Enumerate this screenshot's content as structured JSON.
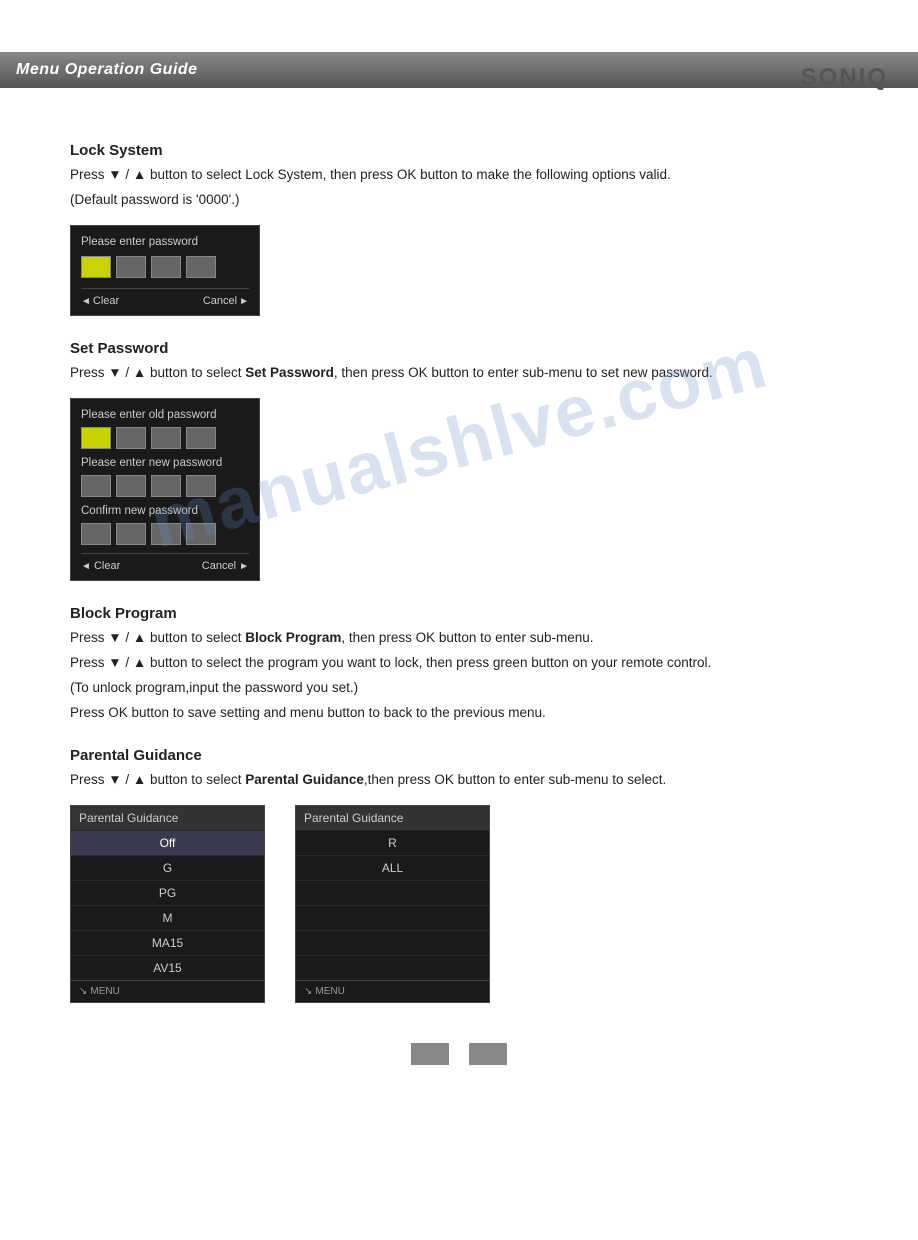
{
  "logo": {
    "text": "SONIQ"
  },
  "header": {
    "title": "Menu Operation Guide"
  },
  "sections": {
    "lock_system": {
      "title": "Lock System",
      "desc1": "Press ▼ / ▲ button to select Lock System, then press OK button to make the following options valid.",
      "desc2": "(Default password is '0000'.)",
      "dialog": {
        "label": "Please enter password",
        "boxes": [
          "active",
          "inactive",
          "inactive",
          "inactive"
        ],
        "footer_left": "◄Clear",
        "footer_right": "Cancel►"
      }
    },
    "set_password": {
      "title": "Set Password",
      "desc": "Press ▼ / ▲ button to select Set Password, then press OK button to enter sub-menu to set new password.",
      "dialog": {
        "label1": "Please enter old password",
        "boxes1": [
          "active",
          "inactive",
          "inactive",
          "inactive"
        ],
        "label2": "Please enter new password",
        "boxes2": [
          "inactive",
          "inactive",
          "inactive",
          "inactive"
        ],
        "label3": "Confirm new password",
        "boxes3": [
          "inactive",
          "inactive",
          "inactive",
          "inactive"
        ],
        "footer_left": "◄Clear",
        "footer_right": "Cancel►"
      }
    },
    "block_program": {
      "title": "Block Program",
      "desc1": "Press ▼ / ▲ button to select Block Program, then press OK button to enter sub-menu.",
      "desc2": "Press ▼ / ▲ button to select the program you want to lock, then press green button on your remote control.",
      "desc3": "(To unlock program,input the  password you set.)",
      "desc4": "Press OK button to save setting and menu button to back to the previous menu."
    },
    "parental_guidance": {
      "title": "Parental Guidance",
      "desc": "Press ▼ / ▲ button to select Parental Guidance,then press OK  button to enter sub-menu to select.",
      "table1": {
        "header": "Parental Guidance",
        "rows": [
          "Off",
          "G",
          "PG",
          "M",
          "MA15",
          "AV15"
        ],
        "selected_row": "Off",
        "footer": "↘ MENU"
      },
      "table2": {
        "header": "Parental Guidance",
        "rows": [
          "R",
          "ALL",
          "",
          "",
          "",
          ""
        ],
        "footer": "↘ MENU"
      }
    }
  },
  "page": {
    "numbers": [
      "",
      ""
    ]
  },
  "watermark": {
    "text": "manualshlve.com"
  }
}
